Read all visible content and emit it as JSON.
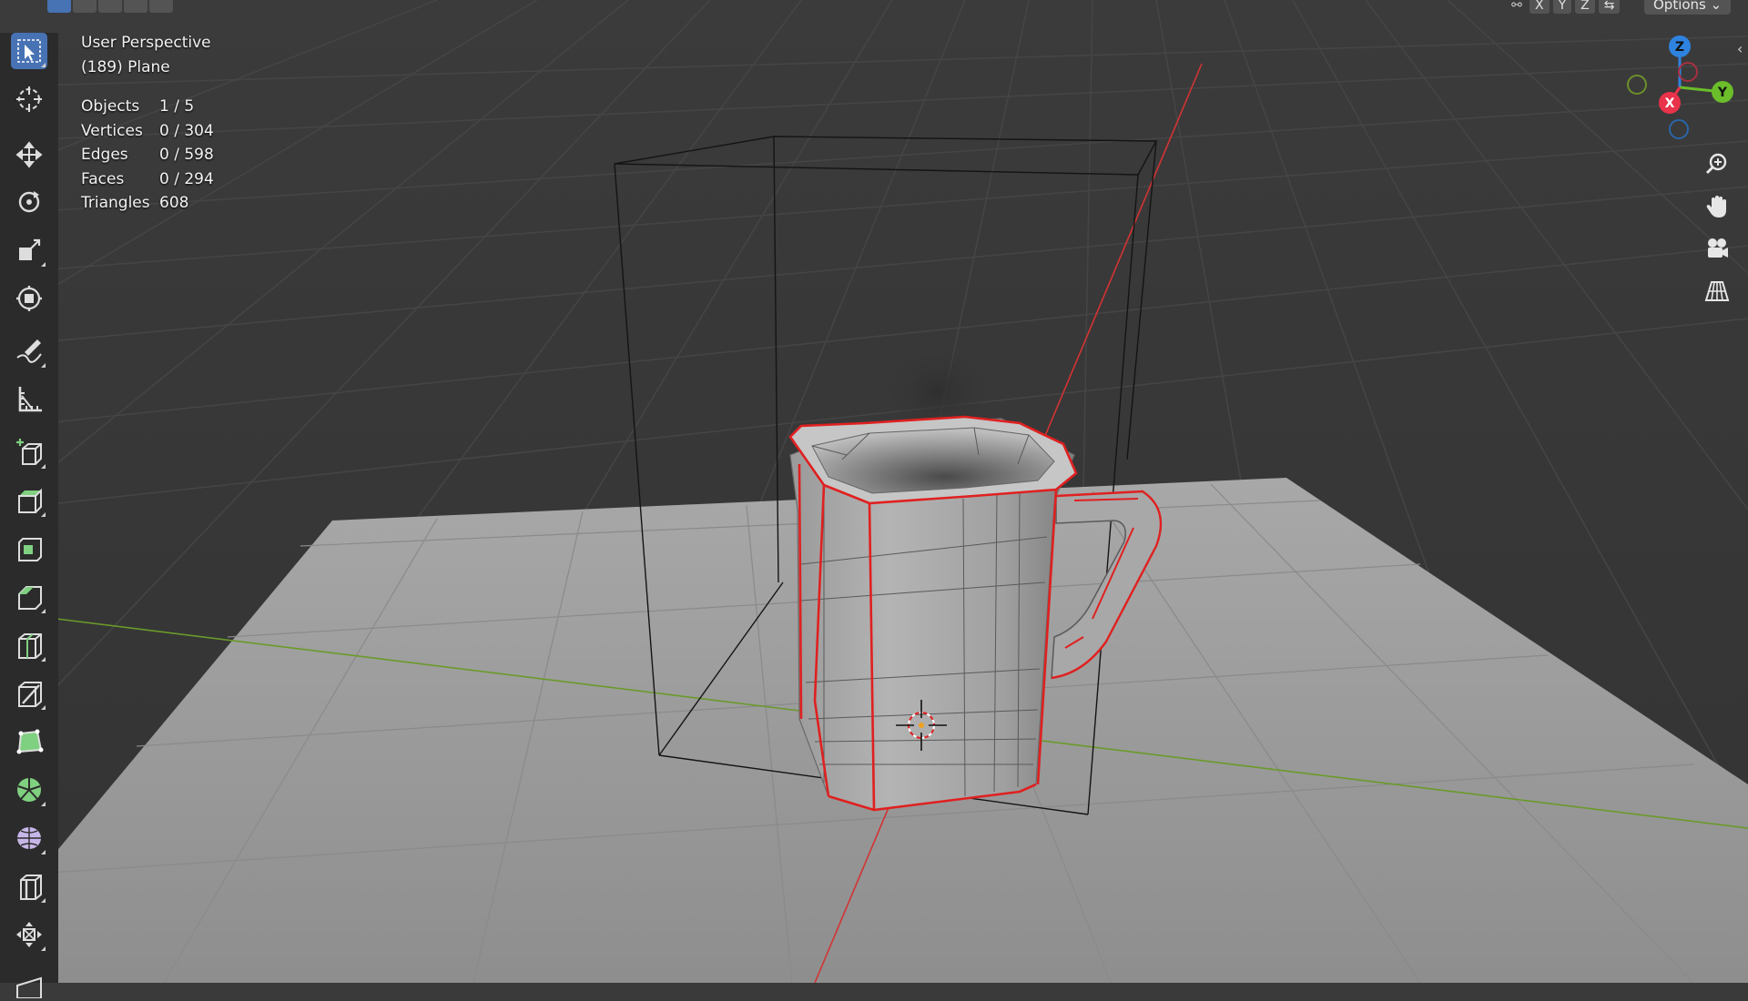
{
  "header": {
    "axis_buttons": [
      "X",
      "Y",
      "Z"
    ],
    "options_label": "Options ⌄"
  },
  "overlay": {
    "view_name": "User Perspective",
    "object_name": "(189) Plane",
    "stats": [
      {
        "label": "Objects",
        "value": "1 / 5"
      },
      {
        "label": "Vertices",
        "value": "0 / 304"
      },
      {
        "label": "Edges",
        "value": "0 / 598"
      },
      {
        "label": "Faces",
        "value": "0 / 294"
      },
      {
        "label": "Triangles",
        "value": "608"
      }
    ]
  },
  "gizmo": {
    "axes": [
      "Z",
      "Y",
      "X"
    ],
    "colors": {
      "x": "#e8334a",
      "y": "#6bbd2a",
      "z": "#2f83e0"
    }
  },
  "toolbar": {
    "tools": [
      "select-box-icon",
      "cursor-icon",
      "move-icon",
      "rotate-icon",
      "scale-icon",
      "transform-icon",
      "annotate-icon",
      "measure-icon",
      "add-cube-icon",
      "extrude-icon",
      "inset-icon",
      "bevel-icon",
      "loop-cut-icon",
      "knife-icon",
      "poly-build-icon",
      "spin-icon",
      "smooth-icon",
      "edge-slide-icon",
      "shrink-fatten-icon"
    ],
    "active_tool": "select-box-icon"
  },
  "nav_buttons": [
    "zoom-icon",
    "pan-hand-icon",
    "camera-icon",
    "perspective-grid-icon"
  ],
  "colors": {
    "viewport_bg": "#3a3a3a",
    "floor": "#9c9c9c",
    "selection_edge": "#e02020",
    "accent": "#4772b3"
  }
}
